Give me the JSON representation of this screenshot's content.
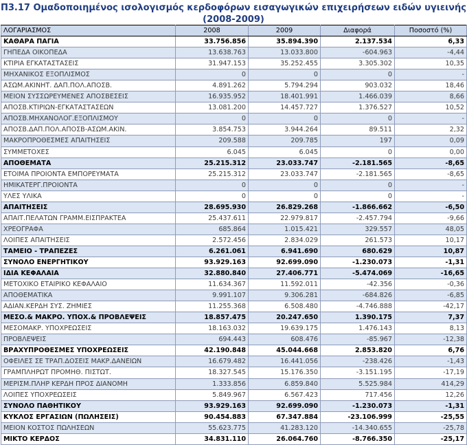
{
  "title_line1": "Π3.17 Ομαδοποιημένος ισολογισμός κερδοφόρων εισαγωγικών επιχειρήσεων ειδών υγιεινής",
  "title_line2": "(2008-2009)",
  "columns": [
    "ΛΟΓΑΡΙΑΣΜΟΣ",
    "2008",
    "2009",
    "Διαφορά",
    "Ποσοστό (%)"
  ],
  "rows": [
    {
      "label": "ΚΑΘΑΡΑ ΠΑΓΙΑ",
      "v2008": "33.756.856",
      "v2009": "35.894.390",
      "diff": "2.137.534",
      "pct": "6,33",
      "bold": true
    },
    {
      "label": "ΓΗΠΕΔΑ ΟΙΚΟΠΕΔΑ",
      "v2008": "13.638.763",
      "v2009": "13.033.800",
      "diff": "-604.963",
      "pct": "-4,44",
      "bold": false
    },
    {
      "label": "ΚΤΙΡΙΑ ΕΓΚΑΤΑΣΤΑΣΕΙΣ",
      "v2008": "31.947.153",
      "v2009": "35.252.455",
      "diff": "3.305.302",
      "pct": "10,35",
      "bold": false
    },
    {
      "label": "ΜΗΧΑΝΙΚΟΣ ΕΞΟΠΛΙΣΜΟΣ",
      "v2008": "0",
      "v2009": "0",
      "diff": "0",
      "pct": "-",
      "bold": false
    },
    {
      "label": "ΑΣΩΜ.ΑΚΙΝΗΤ. ΔΑΠ.ΠΟΛ.ΑΠΟΣΒ.",
      "v2008": "4.891.262",
      "v2009": "5.794.294",
      "diff": "903.032",
      "pct": "18,46",
      "bold": false
    },
    {
      "label": "ΜΕΙΟΝ ΣΥΣΣΩΡΕΥΜΕΝΕΣ ΑΠΟΣΒΕΣΕΙΣ",
      "v2008": "16.935.952",
      "v2009": "18.401.991",
      "diff": "1.466.039",
      "pct": "8,66",
      "bold": false
    },
    {
      "label": "ΑΠΟΣΒ.ΚΤΙΡΙΩΝ-ΕΓΚΑΤΑΣΤΑΣΕΩΝ",
      "v2008": "13.081.200",
      "v2009": "14.457.727",
      "diff": "1.376.527",
      "pct": "10,52",
      "bold": false
    },
    {
      "label": "ΑΠΟΣΒ.ΜΗΧΑΝΟΛΟΓ.ΕΞΟΠΛΙΣΜΟΥ",
      "v2008": "0",
      "v2009": "0",
      "diff": "0",
      "pct": "-",
      "bold": false
    },
    {
      "label": "ΑΠΟΣΒ.ΔΑΠ.ΠΟΛ.ΑΠΟΣΒ-ΑΣΩΜ.ΑΚΙΝ.",
      "v2008": "3.854.753",
      "v2009": "3.944.264",
      "diff": "89.511",
      "pct": "2,32",
      "bold": false
    },
    {
      "label": "ΜΑΚΡΟΠΡΟΘΕΣΜΕΣ ΑΠΑΙΤΗΣΕΙΣ",
      "v2008": "209.588",
      "v2009": "209.785",
      "diff": "197",
      "pct": "0,09",
      "bold": false
    },
    {
      "label": "ΣΥΜΜΕΤΟΧΕΣ",
      "v2008": "6.045",
      "v2009": "6.045",
      "diff": "0",
      "pct": "0,00",
      "bold": false
    },
    {
      "label": "ΑΠΟΘΕΜΑΤΑ",
      "v2008": "25.215.312",
      "v2009": "23.033.747",
      "diff": "-2.181.565",
      "pct": "-8,65",
      "bold": true
    },
    {
      "label": "ΕΤΟΙΜΑ ΠΡΟΙΟΝΤΑ ΕΜΠΟΡΕΥΜΑΤΑ",
      "v2008": "25.215.312",
      "v2009": "23.033.747",
      "diff": "-2.181.565",
      "pct": "-8,65",
      "bold": false
    },
    {
      "label": "ΗΜΙΚΑΤΕΡΓ.ΠΡΟΙΟΝΤΑ",
      "v2008": "0",
      "v2009": "0",
      "diff": "0",
      "pct": "-",
      "bold": false
    },
    {
      "label": "ΥΛΕΣ ΥΛΙΚΑ",
      "v2008": "0",
      "v2009": "0",
      "diff": "0",
      "pct": "-",
      "bold": false
    },
    {
      "label": "ΑΠΑΙΤΗΣΕΙΣ",
      "v2008": "28.695.930",
      "v2009": "26.829.268",
      "diff": "-1.866.662",
      "pct": "-6,50",
      "bold": true
    },
    {
      "label": "ΑΠΑΙΤ.ΠΕΛΑΤΩΝ ΓΡΑΜΜ.ΕΙΣΠΡΑΚΤΕΑ",
      "v2008": "25.437.611",
      "v2009": "22.979.817",
      "diff": "-2.457.794",
      "pct": "-9,66",
      "bold": false
    },
    {
      "label": "ΧΡΕΟΓΡΑΦΑ",
      "v2008": "685.864",
      "v2009": "1.015.421",
      "diff": "329.557",
      "pct": "48,05",
      "bold": false
    },
    {
      "label": "ΛΟΙΠΕΣ ΑΠΑΙΤΗΣΕΙΣ",
      "v2008": "2.572.456",
      "v2009": "2.834.029",
      "diff": "261.573",
      "pct": "10,17",
      "bold": false
    },
    {
      "label": "ΤΑΜΕΙΟ - ΤΡΑΠΕΖΕΣ",
      "v2008": "6.261.061",
      "v2009": "6.941.690",
      "diff": "680.629",
      "pct": "10,87",
      "bold": true
    },
    {
      "label": "ΣΥΝΟΛΟ ΕΝΕΡΓΗΤΙΚΟΥ",
      "v2008": "93.929.163",
      "v2009": "92.699.090",
      "diff": "-1.230.073",
      "pct": "-1,31",
      "bold": true
    },
    {
      "label": "ΙΔΙΑ ΚΕΦΑΛΑΙΑ",
      "v2008": "32.880.840",
      "v2009": "27.406.771",
      "diff": "-5.474.069",
      "pct": "-16,65",
      "bold": true
    },
    {
      "label": "ΜΕΤΟΧΙΚΟ ΕΤΑΙΡΙΚΟ ΚΕΦΑΛΑΙΟ",
      "v2008": "11.634.367",
      "v2009": "11.592.011",
      "diff": "-42.356",
      "pct": "-0,36",
      "bold": false
    },
    {
      "label": "ΑΠΟΘΕΜΑΤΙΚΑ",
      "v2008": "9.991.107",
      "v2009": "9.306.281",
      "diff": "-684.826",
      "pct": "-6,85",
      "bold": false
    },
    {
      "label": "ΑΔΙΑΝ.ΚΕΡΔΗ ΣΥΣ. ΖΗΜΙΕΣ",
      "v2008": "11.255.368",
      "v2009": "6.508.480",
      "diff": "-4.746.888",
      "pct": "-42,17",
      "bold": false
    },
    {
      "label": "ΜΕΣΟ.& ΜΑΚΡΟ. ΥΠΟΧ.& ΠΡΟΒΛΕΨΕΙΣ",
      "v2008": "18.857.475",
      "v2009": "20.247.650",
      "diff": "1.390.175",
      "pct": "7,37",
      "bold": true
    },
    {
      "label": "ΜΕΣΟΜΑΚΡ. ΥΠΟΧΡΕΩΣΕΙΣ",
      "v2008": "18.163.032",
      "v2009": "19.639.175",
      "diff": "1.476.143",
      "pct": "8,13",
      "bold": false
    },
    {
      "label": "ΠΡΟΒΛΕΨΕΙΣ",
      "v2008": "694.443",
      "v2009": "608.476",
      "diff": "-85.967",
      "pct": "-12,38",
      "bold": false
    },
    {
      "label": "ΒΡΑΧΥΠΡΟΘΕΣΜΕΣ ΥΠΟΧΡΕΩΣΕΙΣ",
      "v2008": "42.190.848",
      "v2009": "45.044.668",
      "diff": "2.853.820",
      "pct": "6,76",
      "bold": true
    },
    {
      "label": "ΟΦΕΙΛΕΣ ΣΕ ΤΡΑΠ.ΔΟΣΕΙΣ ΜΑΚΡ.ΔΑΝΕΙΩΝ",
      "v2008": "16.679.482",
      "v2009": "16.441.056",
      "diff": "-238.426",
      "pct": "-1,43",
      "bold": false
    },
    {
      "label": "ΓΡΑΜΠΛΗΡΩΤ ΠΡΟΜΗΘ. ΠΙΣΤΩΤ.",
      "v2008": "18.327.545",
      "v2009": "15.176.350",
      "diff": "-3.151.195",
      "pct": "-17,19",
      "bold": false
    },
    {
      "label": "ΜΕΡΙΣΜ.ΠΛΗΡ ΚΕΡΔΗ ΠΡΟΣ ΔΙΑΝΟΜΗ",
      "v2008": "1.333.856",
      "v2009": "6.859.840",
      "diff": "5.525.984",
      "pct": "414,29",
      "bold": false
    },
    {
      "label": "ΛΟΙΠΕΣ ΥΠΟΧΡΕΩΣΕΙΣ",
      "v2008": "5.849.967",
      "v2009": "6.567.423",
      "diff": "717.456",
      "pct": "12,26",
      "bold": false
    },
    {
      "label": "ΣΥΝΟΛΟ ΠΑΘΗΤΙΚΟΥ",
      "v2008": "93.929.163",
      "v2009": "92.699.090",
      "diff": "-1.230.073",
      "pct": "-1,31",
      "bold": true
    },
    {
      "label": "ΚΥΚΛΟΣ ΕΡΓΑΣΙΩΝ (ΠΩΛΗΣΕΙΣ)",
      "v2008": "90.454.883",
      "v2009": "67.347.884",
      "diff": "-23.106.999",
      "pct": "-25,55",
      "bold": true
    },
    {
      "label": "ΜΕΙΟΝ ΚΟΣΤΟΣ ΠΩΛΗΣΕΩΝ",
      "v2008": "55.623.775",
      "v2009": "41.283.120",
      "diff": "-14.340.655",
      "pct": "-25,78",
      "bold": false
    },
    {
      "label": "ΜΙΚΤΟ ΚΕΡΔΟΣ",
      "v2008": "34.831.110",
      "v2009": "26.064.760",
      "diff": "-8.766.350",
      "pct": "-25,17",
      "bold": true
    }
  ]
}
